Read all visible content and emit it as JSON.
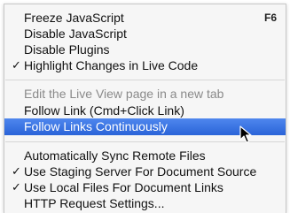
{
  "menu": {
    "items": [
      {
        "label": "Freeze JavaScript",
        "shortcut": "F6",
        "checked": false,
        "enabled": true,
        "highlighted": false
      },
      {
        "label": "Disable JavaScript",
        "shortcut": "",
        "checked": false,
        "enabled": true,
        "highlighted": false
      },
      {
        "label": "Disable Plugins",
        "shortcut": "",
        "checked": false,
        "enabled": true,
        "highlighted": false
      },
      {
        "label": "Highlight Changes in Live Code",
        "shortcut": "",
        "checked": true,
        "enabled": true,
        "highlighted": false
      },
      {
        "label": "Edit the Live View page in a new tab",
        "shortcut": "",
        "checked": false,
        "enabled": false,
        "highlighted": false
      },
      {
        "label": "Follow Link (Cmd+Click Link)",
        "shortcut": "",
        "checked": false,
        "enabled": true,
        "highlighted": false
      },
      {
        "label": "Follow Links Continuously",
        "shortcut": "",
        "checked": false,
        "enabled": true,
        "highlighted": true
      },
      {
        "label": "Automatically Sync Remote Files",
        "shortcut": "",
        "checked": false,
        "enabled": true,
        "highlighted": false
      },
      {
        "label": "Use Staging Server For Document Source",
        "shortcut": "",
        "checked": true,
        "enabled": true,
        "highlighted": false
      },
      {
        "label": "Use Local Files For Document Links",
        "shortcut": "",
        "checked": true,
        "enabled": true,
        "highlighted": false
      },
      {
        "label": "HTTP Request Settings...",
        "shortcut": "",
        "checked": false,
        "enabled": true,
        "highlighted": false
      }
    ],
    "check_glyph": "✓",
    "icons": {
      "check": "checkmark-icon",
      "cursor": "arrow-cursor-icon"
    },
    "colors": {
      "highlight": "#2f6cde",
      "background": "#f6f6f6",
      "disabled_text": "#8a8a8a"
    }
  }
}
